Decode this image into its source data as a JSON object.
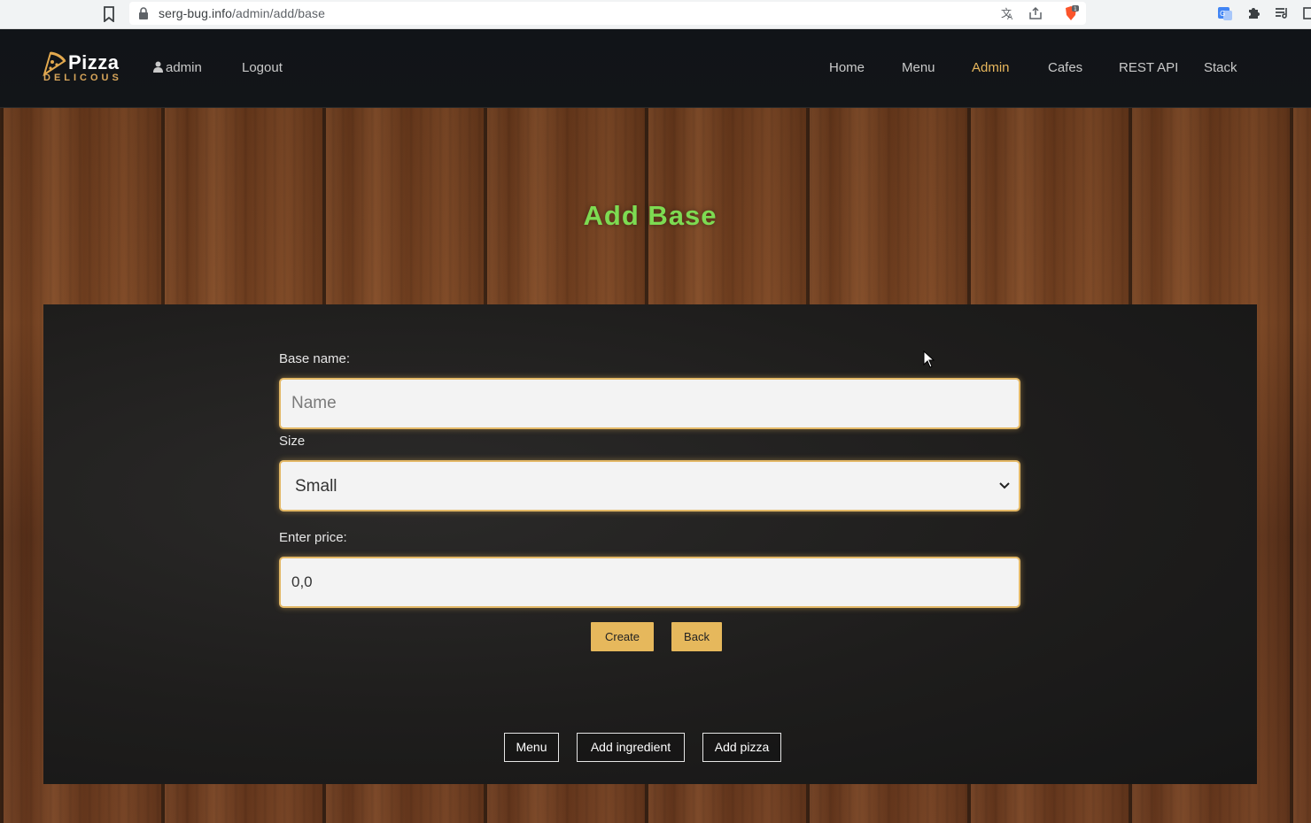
{
  "browser": {
    "url_host": "serg-bug.info",
    "url_path": "/admin/add/base",
    "icons": [
      "bookmark-icon",
      "lock-icon",
      "translate-icon",
      "share-icon",
      "brave-shield-icon",
      "google-translate-icon",
      "extensions-icon",
      "reading-list-icon"
    ]
  },
  "header": {
    "logo_title": "Pizza",
    "logo_subtitle": "DELICOUS",
    "user_label": "admin",
    "logout_label": "Logout",
    "nav": [
      {
        "label": "Home",
        "active": false
      },
      {
        "label": "Menu",
        "active": false
      },
      {
        "label": "Admin",
        "active": true
      },
      {
        "label": "Cafes",
        "active": false
      },
      {
        "label": "REST API",
        "active": false
      },
      {
        "label": "Stack",
        "active": false
      }
    ]
  },
  "page": {
    "title": "Add Base"
  },
  "form": {
    "name_label": "Base name:",
    "name_placeholder": "Name",
    "name_value": "",
    "size_label": "Size",
    "size_selected": "Small",
    "price_label": "Enter price:",
    "price_value": "0,0",
    "create_label": "Create",
    "back_label": "Back"
  },
  "footer_links": {
    "menu_label": "Menu",
    "add_ingredient_label": "Add ingredient",
    "add_pizza_label": "Add pizza"
  },
  "colors": {
    "accent": "#e6b85c",
    "title_green": "#7ddb52",
    "header_bg": "#121518",
    "card_bg": "#1e1d1c"
  }
}
